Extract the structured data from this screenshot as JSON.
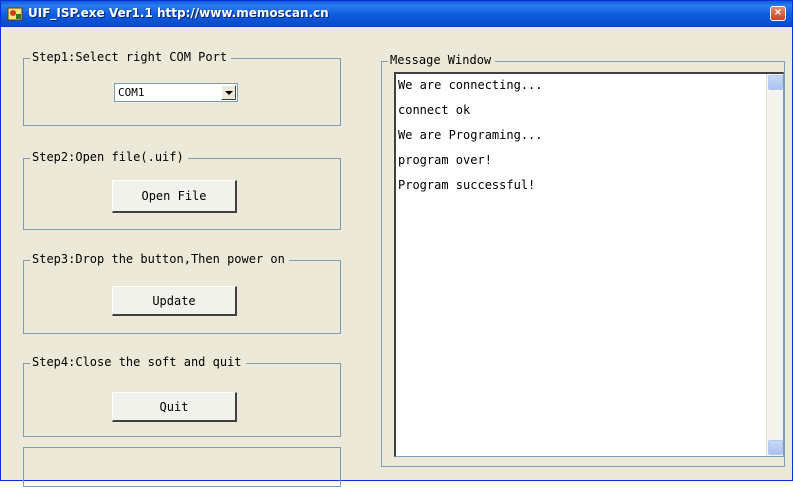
{
  "window": {
    "title": "UIF_ISP.exe  Ver1.1 http://www.memoscan.cn",
    "close_glyph": "×"
  },
  "step1": {
    "legend": "Step1:Select right COM Port",
    "com_port": "COM1"
  },
  "step2": {
    "legend": "Step2:Open file(.uif)",
    "button_label": "Open File"
  },
  "step3": {
    "legend": "Step3:Drop the button,Then power on",
    "button_label": "Update"
  },
  "step4": {
    "legend": "Step4:Close the soft and quit",
    "button_label": "Quit"
  },
  "message_window": {
    "legend": "Message Window",
    "lines": [
      "We are connecting...",
      "connect ok",
      "We are Programing...",
      "program over!",
      "Program successful!"
    ]
  },
  "icons": {
    "app": "app-icon",
    "close": "close-icon",
    "dropdown": "chevron-down-icon",
    "scroll_up": "scroll-up-icon",
    "scroll_down": "scroll-down-icon"
  }
}
